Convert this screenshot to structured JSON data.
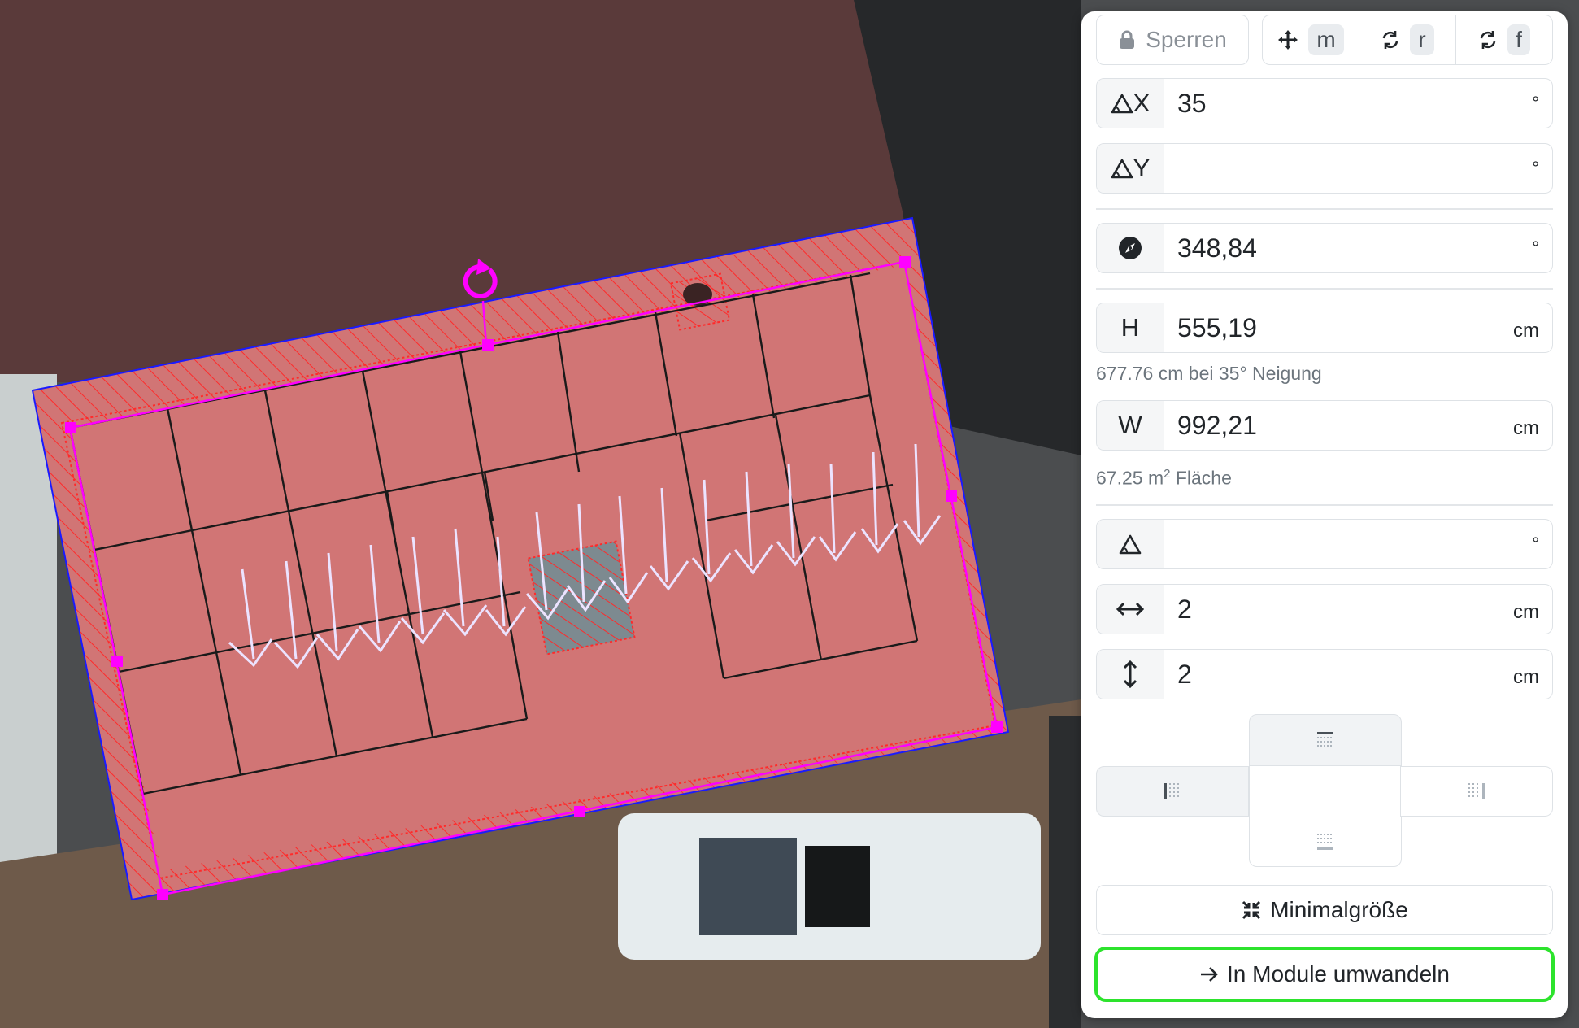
{
  "toolbar": {
    "lock_label": "Sperren",
    "move_key": "m",
    "rotate_key": "r",
    "flip_key": "f"
  },
  "tilt_x": {
    "prefix": "X",
    "value": "35",
    "unit": "°"
  },
  "tilt_y": {
    "prefix": "Y",
    "value": "",
    "unit": "°"
  },
  "azimuth": {
    "value": "348,84",
    "unit": "°"
  },
  "height": {
    "prefix": "H",
    "value": "555,19",
    "unit": "cm",
    "hint": "677.76 cm bei 35° Neigung"
  },
  "width": {
    "prefix": "W",
    "value": "992,21",
    "unit": "cm",
    "hint_value": "67.25 m",
    "hint_sup": "2",
    "hint_rest": " Fläche"
  },
  "module_tilt": {
    "value": "",
    "unit": "°"
  },
  "gap_horizontal": {
    "value": "2",
    "unit": "cm"
  },
  "gap_vertical": {
    "value": "2",
    "unit": "cm"
  },
  "alignment": {
    "active": [
      "top",
      "left"
    ]
  },
  "min_size_label": "Minimalgröße",
  "convert_label": "In Module umwandeln",
  "colors": {
    "accent_green": "#2de32d",
    "handle_magenta": "#ff00ff",
    "frame_blue": "#1a1aff",
    "hatch_red": "#ff3333"
  },
  "map": {
    "icons": [
      "rotate-handle-icon",
      "fall-line-arrows",
      "resize-handles"
    ]
  }
}
